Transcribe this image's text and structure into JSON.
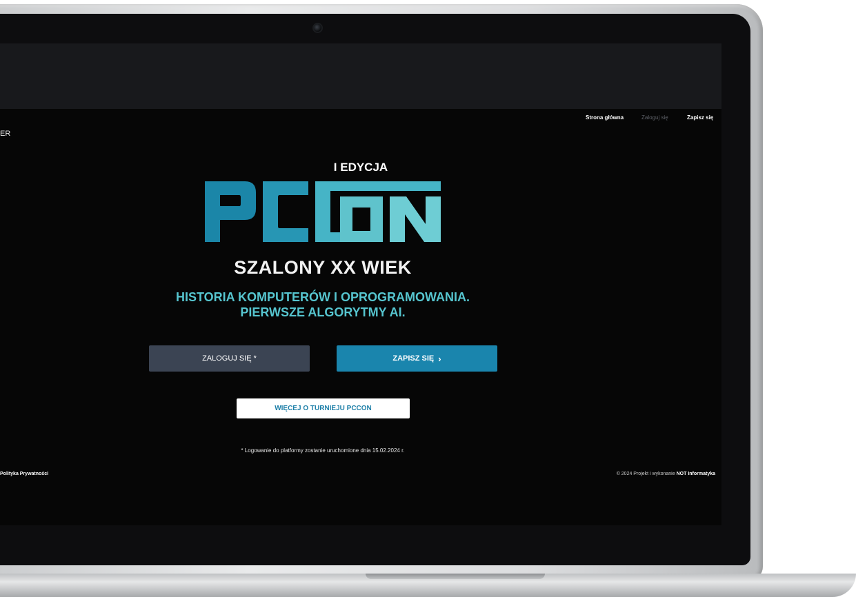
{
  "nav": {
    "home": "Strona główna",
    "login": "Zaloguj się",
    "signup": "Zapisz się"
  },
  "brand_partial": "ER",
  "hero": {
    "edition": "I EDYCJA",
    "logo_text": "PCCON",
    "headline": "SZALONY XX WIEK",
    "subtitle_line1": "HISTORIA KOMPUTERÓW I OPROGRAMOWANIA.",
    "subtitle_line2": "PIERWSZE ALGORYTMY AI."
  },
  "buttons": {
    "login": "ZALOGUJ SIĘ *",
    "signup": "ZAPISZ SIĘ",
    "signup_chevron": "›",
    "more": "WIĘCEJ O TURNIEJU PCCON"
  },
  "footer": {
    "note": "* Logowanie do platformy zostanie uruchomione dnia 15.02.2024 r.",
    "privacy": "Polityka Prywatności",
    "copyright_prefix": "© 2024 Projekt i wykonanie",
    "copyright_company_bold": "NOT",
    "copyright_company": "Informatyka"
  },
  "colors": {
    "accent_cyan": "#56c5cf",
    "logo_dark": "#1b86a8",
    "logo_light": "#5fc3cc",
    "signup_button": "#1a85ad",
    "login_button": "#3b4453",
    "background": "#060606"
  }
}
